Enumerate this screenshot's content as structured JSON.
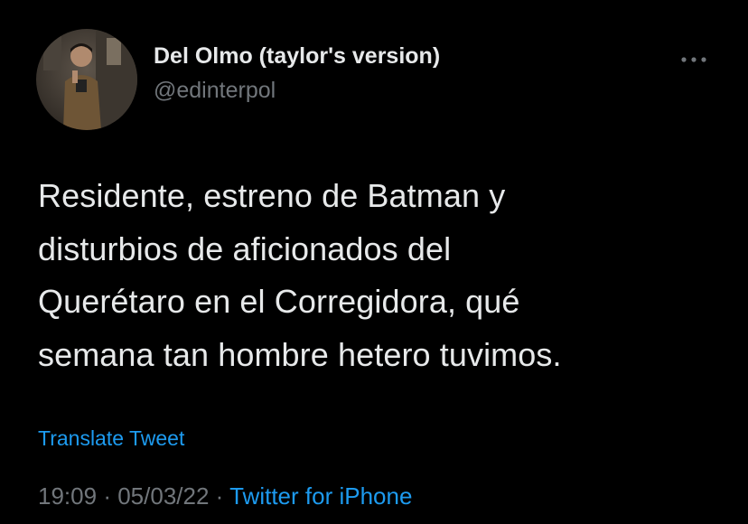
{
  "author": {
    "display_name": "Del Olmo (taylor's version)",
    "handle": "@edinterpol",
    "avatar_icon": "profile-photo"
  },
  "more_icon": "more-horizontal-icon",
  "tweet": {
    "lines": [
      "Residente, estreno de Batman y",
      "disturbios de aficionados del",
      "Querétaro en el Corregidora, qué",
      "semana tan hombre hetero tuvimos."
    ]
  },
  "translate_label": "Translate Tweet",
  "meta": {
    "time": "19:09",
    "separator": "·",
    "date": "05/03/22",
    "source": "Twitter for iPhone"
  },
  "colors": {
    "background": "#000000",
    "text": "#e7e9ea",
    "secondary": "#71767b",
    "accent": "#1d9bf0"
  }
}
